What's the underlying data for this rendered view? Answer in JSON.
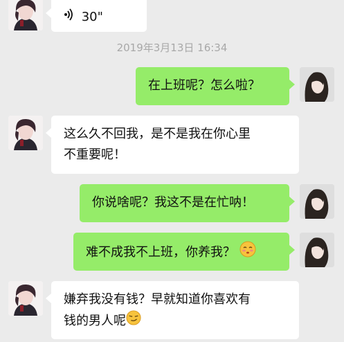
{
  "messages": [
    {
      "side": "left",
      "kind": "voice",
      "duration": "30\""
    },
    {
      "side": "meta",
      "timestamp": "2019年3月13日 16:34"
    },
    {
      "side": "right",
      "text": "在上班呢？怎么啦？"
    },
    {
      "side": "left",
      "lines": [
        "这么久不回我，是不是我在你心里",
        "不重要呢！"
      ]
    },
    {
      "side": "right",
      "text": "你说啥呢？我这不是在忙呐！"
    },
    {
      "side": "right",
      "text": "难不成我不上班，你养我？",
      "emoji": "shy-face"
    },
    {
      "side": "left",
      "lines": [
        "嫌弃我没有钱？早就知道你喜欢有",
        "钱的男人呢"
      ],
      "emoji": "smirk-face"
    }
  ],
  "colors": {
    "background": "#ebebeb",
    "bubble_self": "#95ec69",
    "bubble_other": "#ffffff",
    "timestamp_text": "#a8a8a8"
  }
}
